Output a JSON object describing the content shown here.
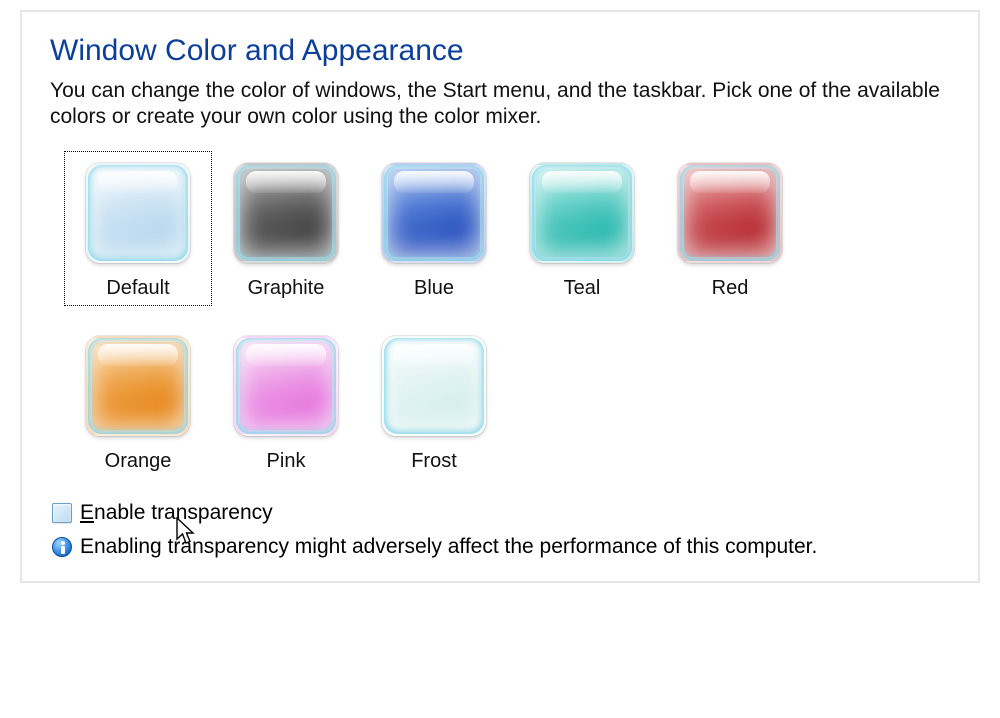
{
  "header": {
    "title": "Window Color and Appearance",
    "description": "You can change the color of windows, the Start menu, and the taskbar. Pick one of the available colors or create your own color using the color mixer."
  },
  "swatches": [
    {
      "id": "default",
      "label": "Default",
      "fill_top": "#eaf3fc",
      "fill_bottom": "#b9d9ef",
      "selected": true
    },
    {
      "id": "graphite",
      "label": "Graphite",
      "fill_top": "#8b8b8b",
      "fill_bottom": "#454545",
      "selected": false
    },
    {
      "id": "blue",
      "label": "Blue",
      "fill_top": "#7aa5ec",
      "fill_bottom": "#2d56c1",
      "selected": false
    },
    {
      "id": "teal",
      "label": "Teal",
      "fill_top": "#9fe8e3",
      "fill_bottom": "#2dbab0",
      "selected": false
    },
    {
      "id": "red",
      "label": "Red",
      "fill_top": "#e98a8c",
      "fill_bottom": "#b82f35",
      "selected": false
    },
    {
      "id": "orange",
      "label": "Orange",
      "fill_top": "#f8c784",
      "fill_bottom": "#e88a1f",
      "selected": false
    },
    {
      "id": "pink",
      "label": "Pink",
      "fill_top": "#f6d2f2",
      "fill_bottom": "#e779df",
      "selected": false
    },
    {
      "id": "frost",
      "label": "Frost",
      "fill_top": "#f4fbfb",
      "fill_bottom": "#d7efef",
      "selected": false
    }
  ],
  "transparency": {
    "checkbox_label_prefix": "E",
    "checkbox_label_rest": "nable transparency",
    "checked": false
  },
  "info": {
    "text": "Enabling transparency might adversely affect the performance of this computer."
  }
}
